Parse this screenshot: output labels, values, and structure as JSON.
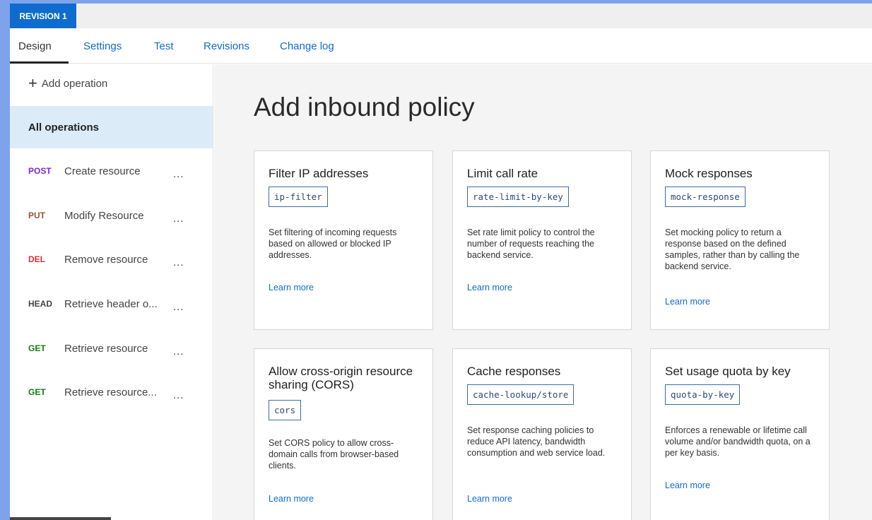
{
  "revision_label": "REVISION 1",
  "tabs": [
    {
      "label": "Design"
    },
    {
      "label": "Settings"
    },
    {
      "label": "Test"
    },
    {
      "label": "Revisions"
    },
    {
      "label": "Change log"
    }
  ],
  "sidebar": {
    "add_operation": "Add operation",
    "all_operations": "All operations",
    "more": "...",
    "operations": [
      {
        "verb": "POST",
        "name": "Create resource",
        "color": "#7a28d6"
      },
      {
        "verb": "PUT",
        "name": "Modify Resource",
        "color": "#a0522d"
      },
      {
        "verb": "DEL",
        "name": "Remove resource",
        "color": "#d13438"
      },
      {
        "verb": "HEAD",
        "name": "Retrieve header o...",
        "color": "#444444"
      },
      {
        "verb": "GET",
        "name": "Retrieve resource",
        "color": "#107c10"
      },
      {
        "verb": "GET",
        "name": "Retrieve resource...",
        "color": "#107c10"
      }
    ]
  },
  "main": {
    "heading": "Add inbound policy",
    "learn_more": "Learn more",
    "cards": [
      {
        "title": "Filter IP addresses",
        "code": "ip-filter",
        "description": "Set filtering of incoming requests based on allowed or blocked IP addresses."
      },
      {
        "title": "Limit call rate",
        "code": "rate-limit-by-key",
        "description": "Set rate limit policy to control the number of requests reaching the backend service."
      },
      {
        "title": "Mock responses",
        "code": "mock-response",
        "description": "Set mocking policy to return a response based on the defined samples, rather than by calling the backend service."
      },
      {
        "title": "Allow cross-origin resource sharing (CORS)",
        "code": "cors",
        "description": "Set CORS policy to allow cross-domain calls from browser-based clients."
      },
      {
        "title": "Cache responses",
        "code": "cache-lookup/store",
        "description": "Set response caching policies to reduce API latency, bandwidth consumption and web service load."
      },
      {
        "title": "Set usage quota by key",
        "code": "quota-by-key",
        "description": "Enforces a renewable or lifetime call volume and/or bandwidth quota, on a per key basis."
      }
    ]
  }
}
